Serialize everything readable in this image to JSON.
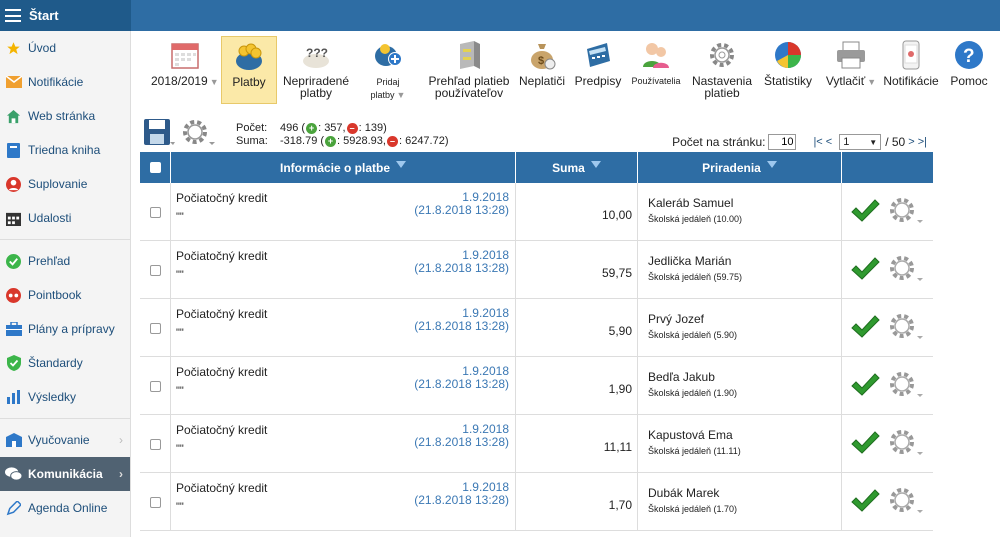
{
  "topbar": {
    "title": "Štart"
  },
  "sidebar": {
    "items": [
      {
        "label": "Úvod",
        "icon": "star-icon",
        "color": "#f4b400"
      },
      {
        "label": "Notifikácie",
        "icon": "mail-icon",
        "color": "#f0a030"
      },
      {
        "label": "Web stránka",
        "icon": "home-icon",
        "color": "#3aa06a"
      },
      {
        "label": "Triedna kniha",
        "icon": "book-icon",
        "color": "#2e78c8"
      },
      {
        "label": "Suplovanie",
        "icon": "person-icon",
        "color": "#d9372b"
      },
      {
        "label": "Udalosti",
        "icon": "calendar-icon",
        "color": "#333333"
      },
      {
        "label": "Prehľad",
        "icon": "check-circle-icon",
        "color": "#3cb54a"
      },
      {
        "label": "Pointbook",
        "icon": "pointbook-icon",
        "color": "#d9372b"
      },
      {
        "label": "Plány a prípravy",
        "icon": "briefcase-icon",
        "color": "#2e78c8"
      },
      {
        "label": "Štandardy",
        "icon": "shield-check-icon",
        "color": "#3cb54a"
      },
      {
        "label": "Výsledky",
        "icon": "bar-chart-icon",
        "color": "#2e78c8"
      },
      {
        "label": "Vyučovanie",
        "icon": "school-icon",
        "color": "#2e78c8"
      },
      {
        "label": "Komunikácia",
        "icon": "chat-icon",
        "color": "#ffffff"
      },
      {
        "label": "Agenda Online",
        "icon": "pen-icon",
        "color": "#2e78c8"
      }
    ]
  },
  "toolbar": {
    "year": "2018/2019",
    "platby": "Platby",
    "nepriradene_1": "Nepriradené",
    "nepriradene_2": "platby",
    "pridaj": "Pridaj platby",
    "prehlad_1": "Prehľad platieb",
    "prehlad_2": "používateľov",
    "neplatici": "Neplatiči",
    "predpisy": "Predpisy",
    "pouzivatelia": "Používatelia",
    "nastavenia_1": "Nastavenia",
    "nastavenia_2": "platieb",
    "statistiky": "Štatistiky",
    "vytlacit": "Vytlačiť",
    "notifikacie": "Notifikácie",
    "pomoc": "Pomoc"
  },
  "summary": {
    "pocet_label": "Počet:",
    "pocet_total": "496 (",
    "pocet_plus": ": 357,",
    "pocet_minus": ": 139)",
    "suma_label": "Suma:",
    "suma_total": "-318.79 (",
    "suma_plus": ": 5928.93,",
    "suma_minus": ": 6247.72)"
  },
  "pager": {
    "per_page_label": "Počet na stránku:",
    "per_page_value": "10",
    "first_prev": "|< <",
    "page": "1",
    "of": "/ 50",
    "next_last": "> >|"
  },
  "table": {
    "headers": {
      "info": "Informácie o platbe",
      "suma": "Suma",
      "priradenia": "Priradenia"
    },
    "rows": [
      {
        "title": "Počiatočný kredit",
        "sub": "\"\"",
        "date": "1.9.2018",
        "created": "(21.8.2018 13:28)",
        "sum": "10,00",
        "name": "Kaleráb Samuel",
        "assign": "Školská jedáleň (10.00)"
      },
      {
        "title": "Počiatočný kredit",
        "sub": "\"\"",
        "date": "1.9.2018",
        "created": "(21.8.2018 13:28)",
        "sum": "59,75",
        "name": "Jedlička Marián",
        "assign": "Školská jedáleň (59.75)"
      },
      {
        "title": "Počiatočný kredit",
        "sub": "\"\"",
        "date": "1.9.2018",
        "created": "(21.8.2018 13:28)",
        "sum": "5,90",
        "name": "Prvý Jozef",
        "assign": "Školská jedáleň (5.90)"
      },
      {
        "title": "Počiatočný kredit",
        "sub": "\"\"",
        "date": "1.9.2018",
        "created": "(21.8.2018 13:28)",
        "sum": "1,90",
        "name": "Bedľa Jakub",
        "assign": "Školská jedáleň (1.90)"
      },
      {
        "title": "Počiatočný kredit",
        "sub": "\"\"",
        "date": "1.9.2018",
        "created": "(21.8.2018 13:28)",
        "sum": "11,11",
        "name": "Kapustová Ema",
        "assign": "Školská jedáleň (11.11)"
      },
      {
        "title": "Počiatočný kredit",
        "sub": "\"\"",
        "date": "1.9.2018",
        "created": "(21.8.2018 13:28)",
        "sum": "1,70",
        "name": "Dubák Marek",
        "assign": "Školská jedáleň (1.70)"
      }
    ]
  }
}
